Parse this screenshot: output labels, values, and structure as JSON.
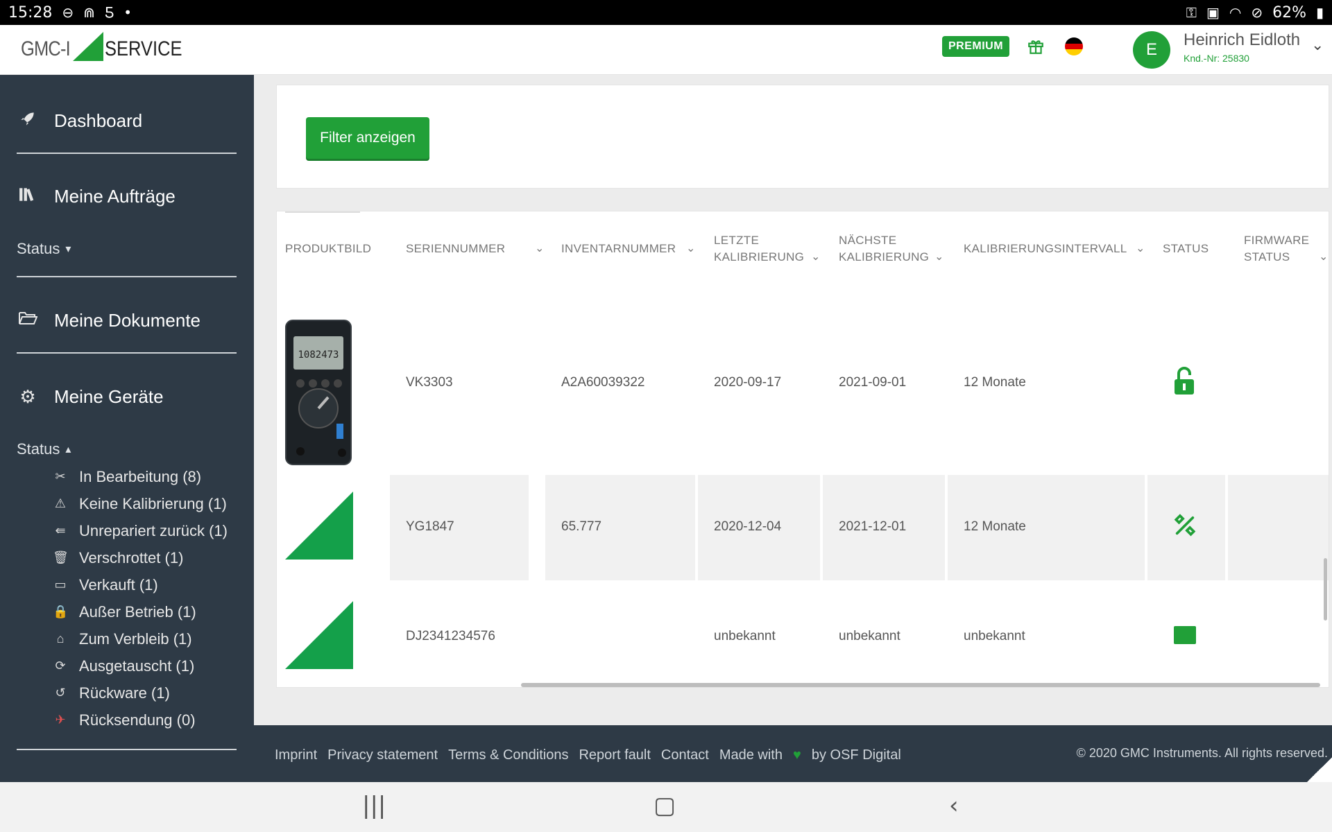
{
  "statusbar": {
    "time": "15:28",
    "battery": "62%"
  },
  "header": {
    "logo_left": "GMC-I",
    "logo_right": "SERVICE",
    "premium_label": "PREMIUM",
    "user_initial": "E",
    "user_name": "Heinrich Eidloth",
    "customer_nr": "Knd.-Nr: 25830",
    "brand_color": "#21a038"
  },
  "sidebar": {
    "dashboard": "Dashboard",
    "orders": "Meine Aufträge",
    "orders_status": "Status",
    "documents": "Meine Dokumente",
    "devices": "Meine Geräte",
    "devices_status": "Status",
    "status_items": [
      {
        "label": "In Bearbeitung (8)",
        "icon": "tools-icon"
      },
      {
        "label": "Keine Kalibrierung (1)",
        "icon": "warning-icon"
      },
      {
        "label": "Unrepariert zurück (1)",
        "icon": "return-icon"
      },
      {
        "label": "Verschrottet (1)",
        "icon": "trash-icon"
      },
      {
        "label": "Verkauft (1)",
        "icon": "sold-icon"
      },
      {
        "label": "Außer Betrieb (1)",
        "icon": "lock-icon"
      },
      {
        "label": "Zum Verbleib (1)",
        "icon": "home-icon"
      },
      {
        "label": "Ausgetauscht (1)",
        "icon": "exchange-icon"
      },
      {
        "label": "Rückware (1)",
        "icon": "undo-icon"
      },
      {
        "label": "Rücksendung (0)",
        "icon": "send-back-icon"
      }
    ]
  },
  "filter": {
    "button_label": "Filter anzeigen"
  },
  "table": {
    "columns": {
      "produktbild": "PRODUKTBILD",
      "seriennummer": "SERIENNUMMER",
      "inventarnummer": "INVENTARNUMMER",
      "letzte_1": "LETZTE",
      "letzte_2": "KALIBRIERUNG",
      "naechste_1": "NÄCHSTE",
      "naechste_2": "KALIBRIERUNG",
      "intervall": "KALIBRIERUNGSINTERVALL",
      "status": "STATUS",
      "firmware_1": "FIRMWARE",
      "firmware_2": "STATUS"
    },
    "rows": [
      {
        "serial": "VK3303",
        "inventory": "A2A60039322",
        "last": "2020-09-17",
        "next": "2021-09-01",
        "interval": "12 Monate",
        "status_icon": "unlock-icon"
      },
      {
        "serial": "YG1847",
        "inventory": "65.777",
        "last": "2020-12-04",
        "next": "2021-12-01",
        "interval": "12 Monate",
        "status_icon": "tools-icon"
      },
      {
        "serial": "DJ2341234576",
        "inventory": "",
        "last": "unbekannt",
        "next": "unbekannt",
        "interval": "unbekannt",
        "status_icon": "come-and-go-icon"
      }
    ],
    "multimeter_display": "1082473"
  },
  "footer": {
    "imprint": "Imprint",
    "privacy": "Privacy statement",
    "terms": "Terms & Conditions",
    "report": "Report fault",
    "contact": "Contact",
    "made_with": "Made with",
    "by": "by OSF Digital",
    "copyright": "© 2020 GMC Instruments. All rights reserved."
  }
}
